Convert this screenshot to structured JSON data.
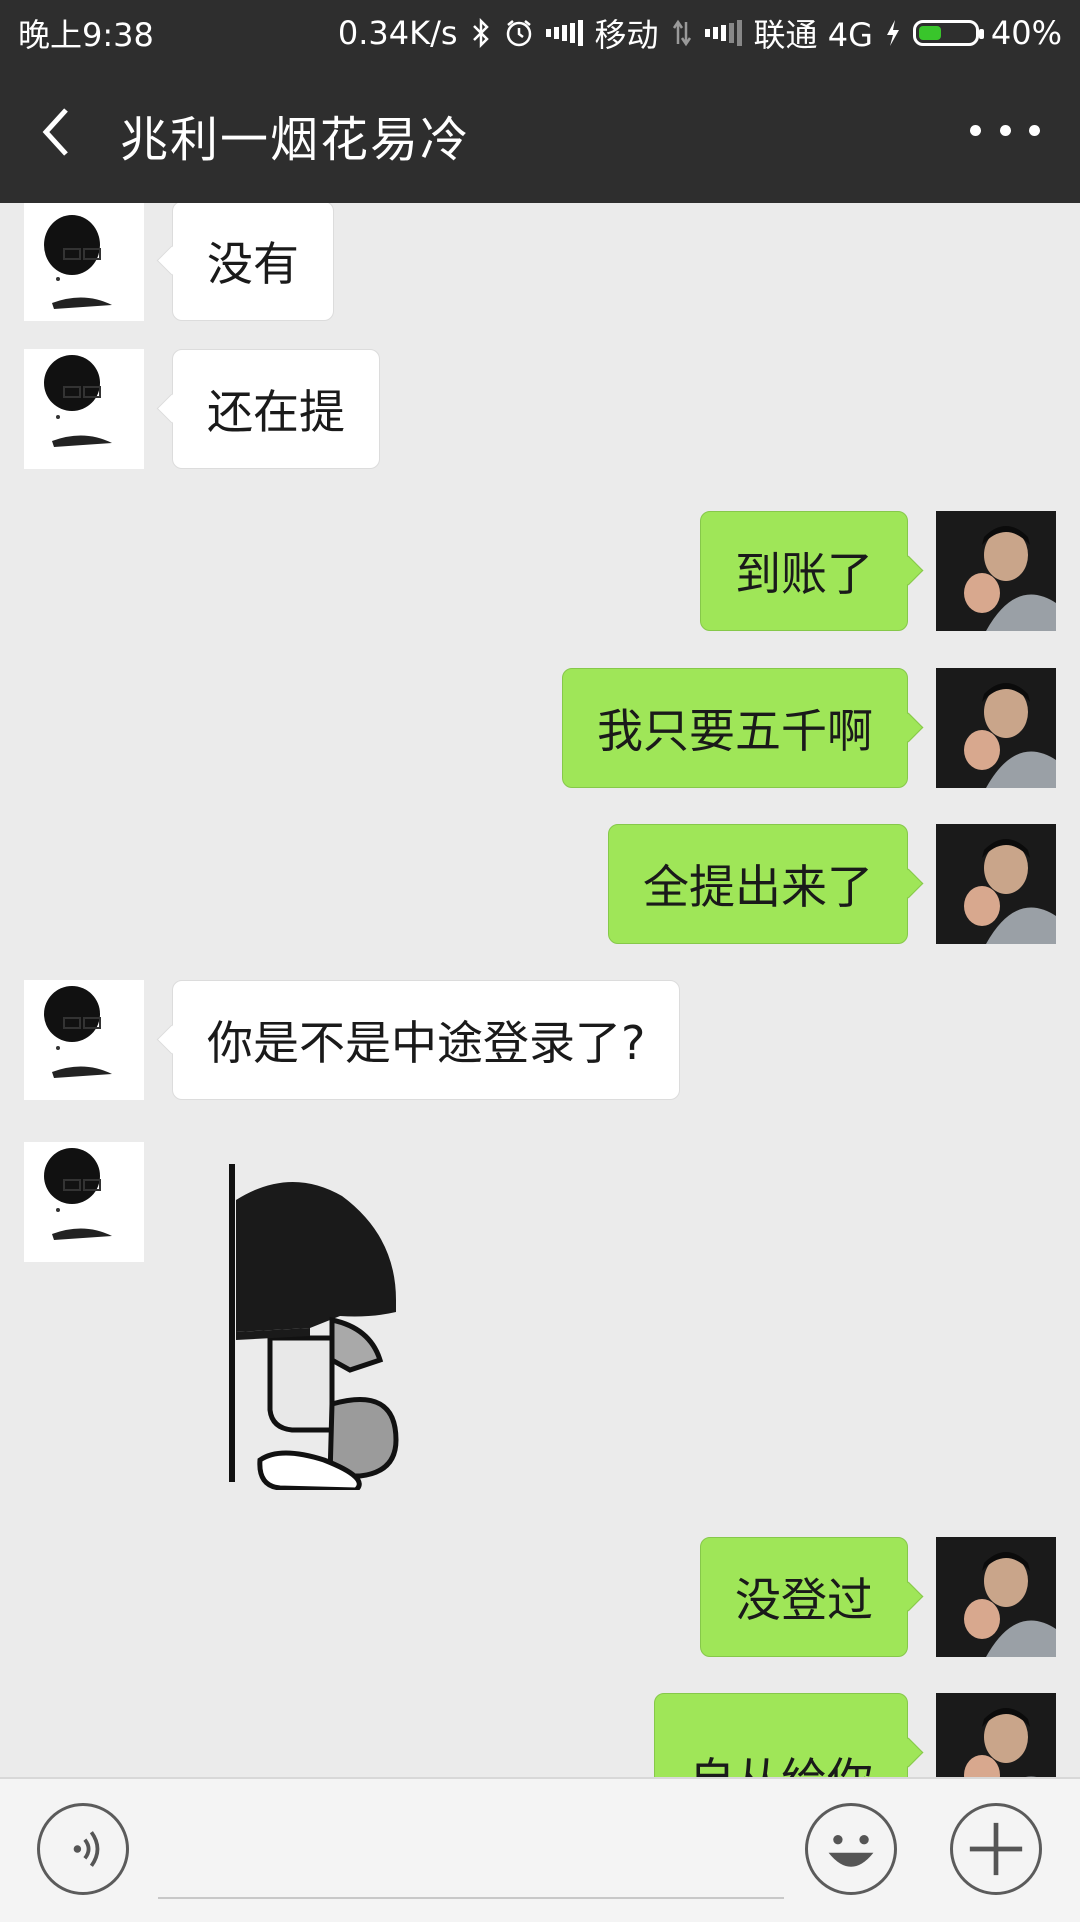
{
  "status_bar": {
    "time": "晚上9:38",
    "net_speed": "0.34K/s",
    "carrier1": "移动",
    "carrier2": "联通 4G",
    "battery": "40%",
    "battery_level": 0.4
  },
  "header": {
    "title": "兆利一烟花易冷"
  },
  "messages": [
    {
      "side": "left",
      "text": "没有"
    },
    {
      "side": "left",
      "text": "还在提"
    },
    {
      "side": "right",
      "text": "到账了"
    },
    {
      "side": "right",
      "text": "我只要五千啊"
    },
    {
      "side": "right",
      "text": "全提出来了"
    },
    {
      "side": "left",
      "text": "你是不是中途登录了?"
    },
    {
      "side": "left",
      "type": "sticker",
      "text": ""
    },
    {
      "side": "right",
      "text": "没登过"
    },
    {
      "side": "right",
      "text": "自从给你"
    }
  ],
  "input": {
    "placeholder": ""
  },
  "icons": {
    "back": "chevron-left-icon",
    "more": "more-dots-icon",
    "voice": "voice-icon",
    "emoji": "emoji-icon",
    "plus": "plus-icon"
  },
  "colors": {
    "header_bg": "#2e2e2e",
    "chat_bg": "#ebebeb",
    "self_bubble": "#9fe658",
    "other_bubble": "#ffffff",
    "battery_fill": "#39c52b"
  }
}
